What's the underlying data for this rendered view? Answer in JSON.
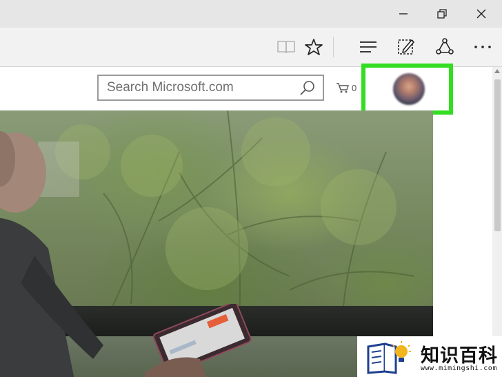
{
  "titlebar": {
    "buttons": [
      "minimize",
      "restore",
      "close"
    ]
  },
  "toolbar": {
    "icons": [
      "reading-view-icon",
      "favorite-star-icon",
      "hub-icon",
      "web-note-icon",
      "share-icon",
      "more-icon"
    ]
  },
  "page": {
    "search": {
      "placeholder": "Search Microsoft.com"
    },
    "cart": {
      "count": "0"
    },
    "account": {
      "avatar": "profile-picture"
    }
  },
  "watermark": {
    "name": "知识百科",
    "url": "www.mimingshi.com"
  },
  "colors": {
    "highlight": "#33dd22",
    "titlebar": "#e6e6e6",
    "toolbar": "#f2f2f2"
  }
}
